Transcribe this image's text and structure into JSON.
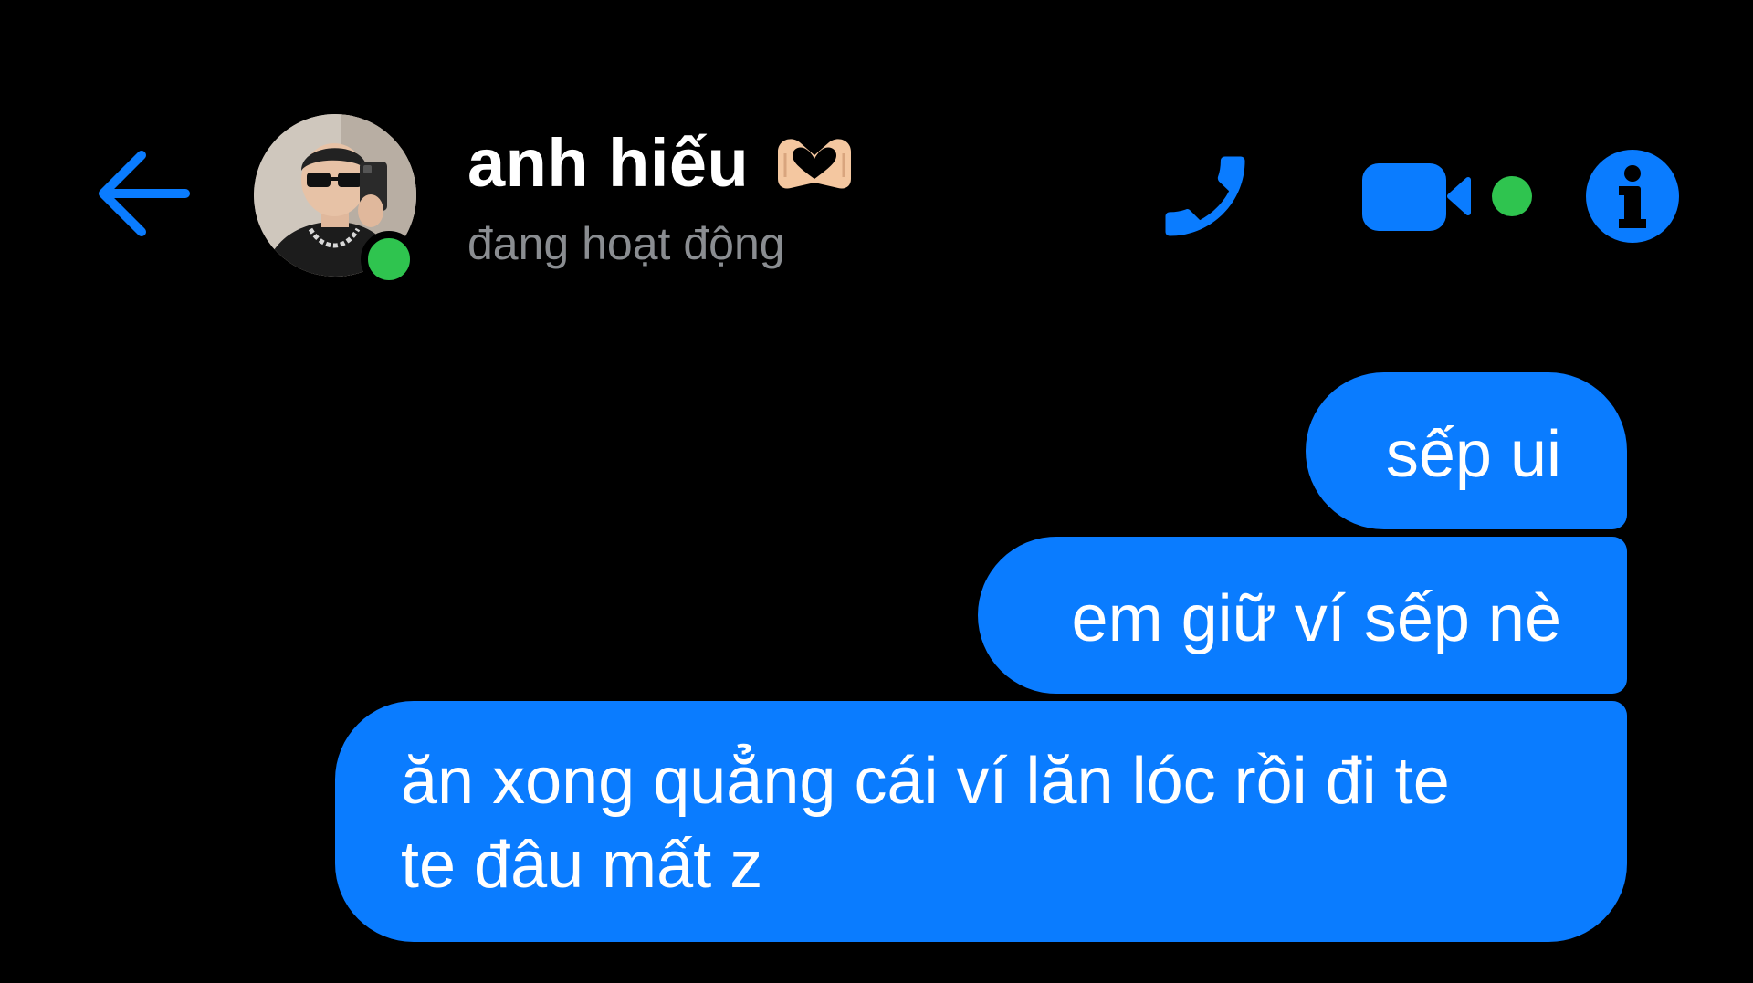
{
  "header": {
    "contact_name": "anh hiếu",
    "contact_status": "đang hoạt động",
    "icons": {
      "back": "back-arrow-icon",
      "avatar_presence": "online-dot",
      "name_emoji": "heart-hands-icon",
      "call": "phone-icon",
      "video": "video-camera-icon",
      "info": "info-icon"
    }
  },
  "messages": [
    {
      "direction": "outgoing",
      "text": "sếp ui"
    },
    {
      "direction": "outgoing",
      "text": "em giữ ví sếp nè"
    },
    {
      "direction": "outgoing",
      "lines": [
        "ăn xong quẳng cái ví lăn lóc rồi đi te",
        "te đâu mất z"
      ]
    }
  ],
  "colors": {
    "background": "#000000",
    "accent": "#0a7cff",
    "bubble": "#0a7cff",
    "online": "#2fc44f",
    "status_text": "#8a8d91",
    "text": "#ffffff"
  }
}
